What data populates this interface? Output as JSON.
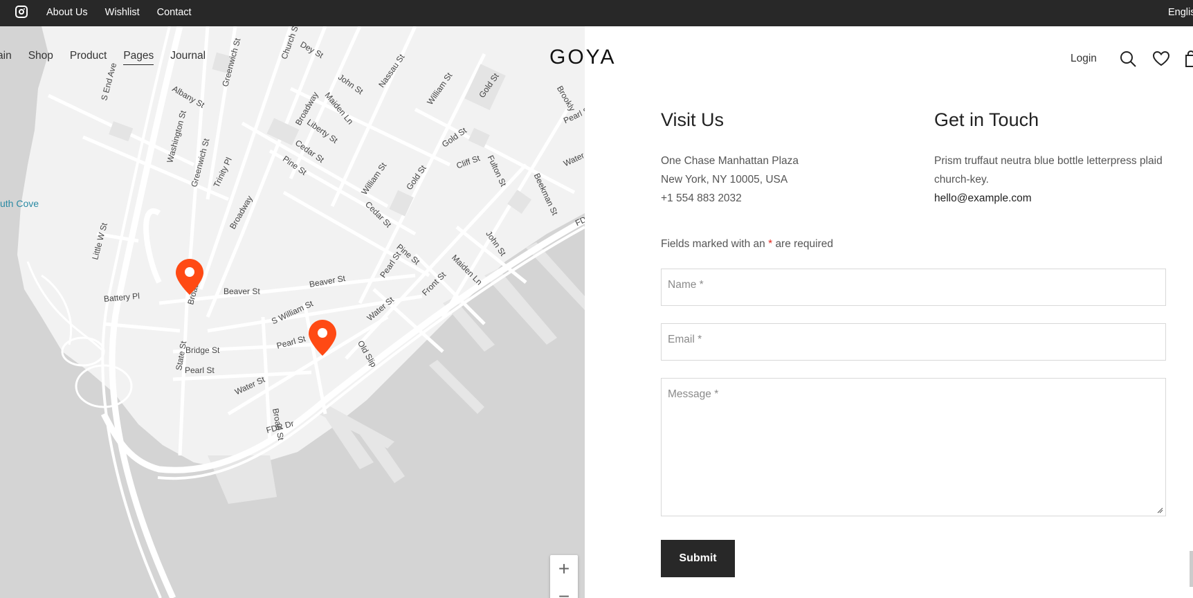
{
  "topbar": {
    "instagram_icon": "instagram-icon",
    "links": [
      "About Us",
      "Wishlist",
      "Contact"
    ],
    "language": "Englis"
  },
  "nav": {
    "items": [
      "ain",
      "Shop",
      "Product",
      "Pages",
      "Journal"
    ],
    "active": "Pages"
  },
  "brand": {
    "logo": "GOYA"
  },
  "header_actions": {
    "login": "Login",
    "search_icon": "search-icon",
    "wishlist_icon": "heart-icon",
    "cart_icon": "cart-icon"
  },
  "map": {
    "labels": {
      "dey": "Dey St",
      "john1": "John St",
      "nassau": "Nassau St",
      "william1": "William St",
      "gold1": "Gold St",
      "church": "Church St",
      "greenwich1": "Greenwich St",
      "send": "S End Ave",
      "albany": "Albany St",
      "washington": "Washington St",
      "greenwich2": "Greenwich St",
      "trinity": "Trinity Pl",
      "broadway1": "Broadway",
      "broadway2": "Broadway",
      "maiden1": "Maiden Ln",
      "liberty": "Liberty St",
      "cedar1": "Cedar St",
      "pine1": "Pine St",
      "william2": "William St",
      "cedar2": "Cedar St",
      "gold2": "Gold St",
      "gold3": "Gold St",
      "cliff": "Cliff St",
      "fulton": "Fulton St",
      "beekman": "Beekman St",
      "pearl1": "Pearl St",
      "water1": "Water St",
      "cove": "uth Cove",
      "littlew": "Little W St",
      "battery": "Battery Pl",
      "broadway3": "Broadway",
      "beaver1": "Beaver St",
      "beaver2": "Beaver St",
      "swilliam": "S William St",
      "pine2": "Pine St",
      "pearl2": "Pearl St",
      "water2": "Water St",
      "john2": "John St",
      "maiden2": "Maiden Ln",
      "front": "Front St",
      "fdr1": "FDR",
      "oldslip": "Old Slip",
      "state": "State St",
      "bridge": "Bridge St",
      "pearl3": "Pearl St",
      "pearl4": "Pearl St",
      "water3": "Water St",
      "broad": "Broad St",
      "fdr2": "FDR Dr",
      "brookly": "Brookly"
    },
    "zoom_in": "+",
    "zoom_out": "−",
    "colors": {
      "land": "#f2f2f2",
      "water": "#d4d4d4",
      "road": "#ffffff",
      "pin": "#ff4a14"
    }
  },
  "visit": {
    "title": "Visit Us",
    "lines": [
      "One Chase Manhattan Plaza",
      "New York, NY 10005, USA",
      "+1 554 883 2032"
    ]
  },
  "touch": {
    "title": "Get in Touch",
    "text_line1": "Prism truffaut neutra blue bottle letterpress plaid",
    "text_line2": "church-key.",
    "email": "hello@example.com"
  },
  "form": {
    "required_before": "Fields marked with an",
    "required_star": "*",
    "required_after": "are required",
    "name_placeholder": "Name *",
    "email_placeholder": "Email *",
    "message_placeholder": "Message *",
    "submit": "Submit"
  }
}
